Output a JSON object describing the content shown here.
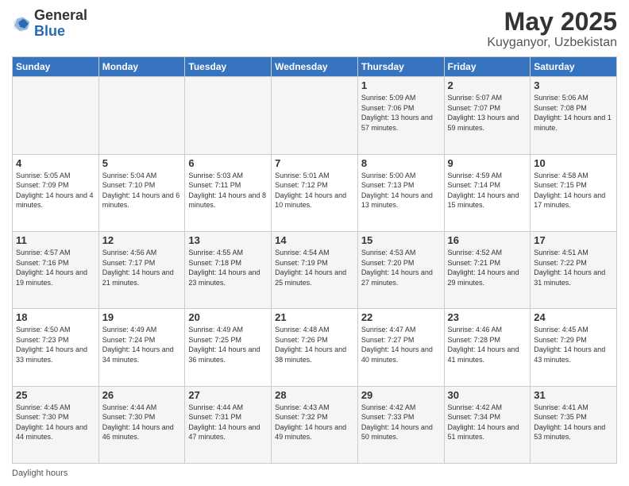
{
  "header": {
    "logo_general": "General",
    "logo_blue": "Blue",
    "title": "May 2025",
    "subtitle": "Kuyganyor, Uzbekistan"
  },
  "days_of_week": [
    "Sunday",
    "Monday",
    "Tuesday",
    "Wednesday",
    "Thursday",
    "Friday",
    "Saturday"
  ],
  "weeks": [
    [
      {
        "day": "",
        "info": ""
      },
      {
        "day": "",
        "info": ""
      },
      {
        "day": "",
        "info": ""
      },
      {
        "day": "",
        "info": ""
      },
      {
        "day": "1",
        "sunrise": "Sunrise: 5:09 AM",
        "sunset": "Sunset: 7:06 PM",
        "daylight": "Daylight: 13 hours and 57 minutes."
      },
      {
        "day": "2",
        "sunrise": "Sunrise: 5:07 AM",
        "sunset": "Sunset: 7:07 PM",
        "daylight": "Daylight: 13 hours and 59 minutes."
      },
      {
        "day": "3",
        "sunrise": "Sunrise: 5:06 AM",
        "sunset": "Sunset: 7:08 PM",
        "daylight": "Daylight: 14 hours and 1 minute."
      }
    ],
    [
      {
        "day": "4",
        "sunrise": "Sunrise: 5:05 AM",
        "sunset": "Sunset: 7:09 PM",
        "daylight": "Daylight: 14 hours and 4 minutes."
      },
      {
        "day": "5",
        "sunrise": "Sunrise: 5:04 AM",
        "sunset": "Sunset: 7:10 PM",
        "daylight": "Daylight: 14 hours and 6 minutes."
      },
      {
        "day": "6",
        "sunrise": "Sunrise: 5:03 AM",
        "sunset": "Sunset: 7:11 PM",
        "daylight": "Daylight: 14 hours and 8 minutes."
      },
      {
        "day": "7",
        "sunrise": "Sunrise: 5:01 AM",
        "sunset": "Sunset: 7:12 PM",
        "daylight": "Daylight: 14 hours and 10 minutes."
      },
      {
        "day": "8",
        "sunrise": "Sunrise: 5:00 AM",
        "sunset": "Sunset: 7:13 PM",
        "daylight": "Daylight: 14 hours and 13 minutes."
      },
      {
        "day": "9",
        "sunrise": "Sunrise: 4:59 AM",
        "sunset": "Sunset: 7:14 PM",
        "daylight": "Daylight: 14 hours and 15 minutes."
      },
      {
        "day": "10",
        "sunrise": "Sunrise: 4:58 AM",
        "sunset": "Sunset: 7:15 PM",
        "daylight": "Daylight: 14 hours and 17 minutes."
      }
    ],
    [
      {
        "day": "11",
        "sunrise": "Sunrise: 4:57 AM",
        "sunset": "Sunset: 7:16 PM",
        "daylight": "Daylight: 14 hours and 19 minutes."
      },
      {
        "day": "12",
        "sunrise": "Sunrise: 4:56 AM",
        "sunset": "Sunset: 7:17 PM",
        "daylight": "Daylight: 14 hours and 21 minutes."
      },
      {
        "day": "13",
        "sunrise": "Sunrise: 4:55 AM",
        "sunset": "Sunset: 7:18 PM",
        "daylight": "Daylight: 14 hours and 23 minutes."
      },
      {
        "day": "14",
        "sunrise": "Sunrise: 4:54 AM",
        "sunset": "Sunset: 7:19 PM",
        "daylight": "Daylight: 14 hours and 25 minutes."
      },
      {
        "day": "15",
        "sunrise": "Sunrise: 4:53 AM",
        "sunset": "Sunset: 7:20 PM",
        "daylight": "Daylight: 14 hours and 27 minutes."
      },
      {
        "day": "16",
        "sunrise": "Sunrise: 4:52 AM",
        "sunset": "Sunset: 7:21 PM",
        "daylight": "Daylight: 14 hours and 29 minutes."
      },
      {
        "day": "17",
        "sunrise": "Sunrise: 4:51 AM",
        "sunset": "Sunset: 7:22 PM",
        "daylight": "Daylight: 14 hours and 31 minutes."
      }
    ],
    [
      {
        "day": "18",
        "sunrise": "Sunrise: 4:50 AM",
        "sunset": "Sunset: 7:23 PM",
        "daylight": "Daylight: 14 hours and 33 minutes."
      },
      {
        "day": "19",
        "sunrise": "Sunrise: 4:49 AM",
        "sunset": "Sunset: 7:24 PM",
        "daylight": "Daylight: 14 hours and 34 minutes."
      },
      {
        "day": "20",
        "sunrise": "Sunrise: 4:49 AM",
        "sunset": "Sunset: 7:25 PM",
        "daylight": "Daylight: 14 hours and 36 minutes."
      },
      {
        "day": "21",
        "sunrise": "Sunrise: 4:48 AM",
        "sunset": "Sunset: 7:26 PM",
        "daylight": "Daylight: 14 hours and 38 minutes."
      },
      {
        "day": "22",
        "sunrise": "Sunrise: 4:47 AM",
        "sunset": "Sunset: 7:27 PM",
        "daylight": "Daylight: 14 hours and 40 minutes."
      },
      {
        "day": "23",
        "sunrise": "Sunrise: 4:46 AM",
        "sunset": "Sunset: 7:28 PM",
        "daylight": "Daylight: 14 hours and 41 minutes."
      },
      {
        "day": "24",
        "sunrise": "Sunrise: 4:45 AM",
        "sunset": "Sunset: 7:29 PM",
        "daylight": "Daylight: 14 hours and 43 minutes."
      }
    ],
    [
      {
        "day": "25",
        "sunrise": "Sunrise: 4:45 AM",
        "sunset": "Sunset: 7:30 PM",
        "daylight": "Daylight: 14 hours and 44 minutes."
      },
      {
        "day": "26",
        "sunrise": "Sunrise: 4:44 AM",
        "sunset": "Sunset: 7:30 PM",
        "daylight": "Daylight: 14 hours and 46 minutes."
      },
      {
        "day": "27",
        "sunrise": "Sunrise: 4:44 AM",
        "sunset": "Sunset: 7:31 PM",
        "daylight": "Daylight: 14 hours and 47 minutes."
      },
      {
        "day": "28",
        "sunrise": "Sunrise: 4:43 AM",
        "sunset": "Sunset: 7:32 PM",
        "daylight": "Daylight: 14 hours and 49 minutes."
      },
      {
        "day": "29",
        "sunrise": "Sunrise: 4:42 AM",
        "sunset": "Sunset: 7:33 PM",
        "daylight": "Daylight: 14 hours and 50 minutes."
      },
      {
        "day": "30",
        "sunrise": "Sunrise: 4:42 AM",
        "sunset": "Sunset: 7:34 PM",
        "daylight": "Daylight: 14 hours and 51 minutes."
      },
      {
        "day": "31",
        "sunrise": "Sunrise: 4:41 AM",
        "sunset": "Sunset: 7:35 PM",
        "daylight": "Daylight: 14 hours and 53 minutes."
      }
    ]
  ],
  "footer": {
    "daylight_label": "Daylight hours"
  }
}
